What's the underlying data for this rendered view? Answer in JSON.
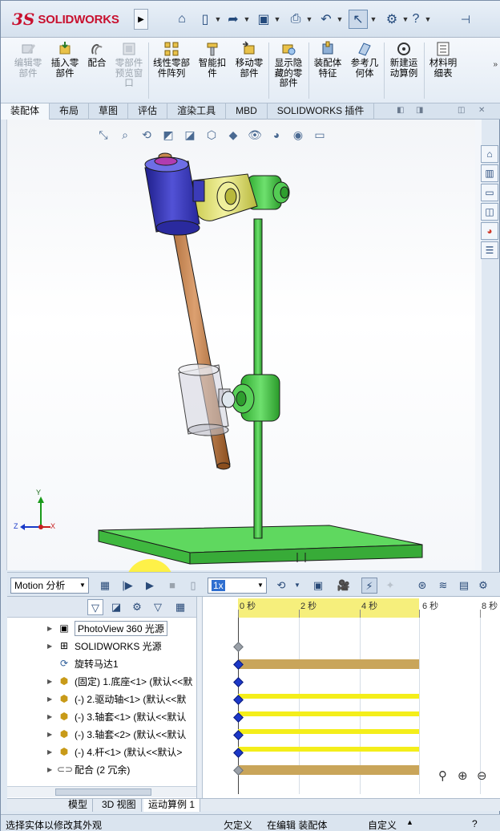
{
  "app": {
    "brand": "SOLIDWORKS",
    "brand_prefix": "3S"
  },
  "quick_access": [
    "home-icon",
    "new-file-icon",
    "open-icon",
    "save-icon",
    "print-icon",
    "undo-icon",
    "select-icon",
    "help-icon"
  ],
  "command_manager": {
    "buttons": [
      {
        "label": "编辑零\n部件",
        "disabled": true,
        "icon": "edit-component-icon"
      },
      {
        "label": "插入零\n部件",
        "disabled": false,
        "icon": "insert-component-icon"
      },
      {
        "label": "配合",
        "disabled": false,
        "icon": "mate-icon"
      },
      {
        "label": "零部件\n预览窗\n口",
        "disabled": true,
        "icon": "component-preview-icon"
      },
      {
        "label": "线性零部\n件阵列",
        "disabled": false,
        "icon": "linear-pattern-icon"
      },
      {
        "label": "智能扣\n件",
        "disabled": false,
        "icon": "smart-fastener-icon"
      },
      {
        "label": "移动零\n部件",
        "disabled": false,
        "icon": "move-component-icon"
      },
      {
        "label": "显示隐\n藏的零\n部件",
        "disabled": false,
        "icon": "show-hidden-icon"
      },
      {
        "label": "装配体\n特征",
        "disabled": false,
        "icon": "assembly-feature-icon"
      },
      {
        "label": "参考几\n何体",
        "disabled": false,
        "icon": "reference-geometry-icon"
      },
      {
        "label": "新建运\n动算例",
        "disabled": false,
        "icon": "new-motion-study-icon"
      },
      {
        "label": "材料明\n细表",
        "disabled": false,
        "icon": "bom-icon"
      }
    ]
  },
  "tabs": [
    "装配体",
    "布局",
    "草图",
    "评估",
    "渲染工具",
    "MBD",
    "SOLIDWORKS 插件"
  ],
  "active_tab": 0,
  "triad": {
    "x": "X",
    "y": "Y",
    "z": "Z"
  },
  "motion_toolbar": {
    "study_type": "Motion 分析",
    "speed": "1x"
  },
  "timeline": {
    "labels": [
      "0 秒",
      "2 秒",
      "4 秒",
      "6 秒",
      "8 秒"
    ]
  },
  "tree": [
    {
      "label": "PhotoView 360 光源",
      "icon": "photoview-icon",
      "expandable": true,
      "boxed": true
    },
    {
      "label": "SOLIDWORKS 光源",
      "icon": "lights-icon",
      "expandable": true,
      "boxed": false
    },
    {
      "label": "旋转马达1",
      "icon": "rotary-motor-icon",
      "expandable": false,
      "boxed": false
    },
    {
      "label": "(固定) 1.底座<1> (默认<<默",
      "icon": "part-icon",
      "expandable": true,
      "boxed": false
    },
    {
      "label": "(-) 2.驱动轴<1> (默认<<默",
      "icon": "part-icon",
      "expandable": true,
      "boxed": false
    },
    {
      "label": "(-) 3.轴套<1> (默认<<默认",
      "icon": "part-icon",
      "expandable": true,
      "boxed": false
    },
    {
      "label": "(-) 3.轴套<2> (默认<<默认",
      "icon": "part-icon",
      "expandable": true,
      "boxed": false
    },
    {
      "label": "(-) 4.杆<1> (默认<<默认>",
      "icon": "part-icon",
      "expandable": true,
      "boxed": false
    },
    {
      "label": "配合 (2 冗余)",
      "icon": "mates-icon",
      "expandable": true,
      "boxed": false
    }
  ],
  "bottom_tabs": [
    "模型",
    "3D 视图",
    "运动算例 1"
  ],
  "active_bottom_tab": 2,
  "status": {
    "left": "选择实体以修改其外观",
    "under_defined": "欠定义",
    "editing": "在编辑 装配体",
    "custom": "自定义"
  },
  "colors": {
    "base_green": "#4fd04f",
    "drive_shaft_tan": "#c8874e",
    "sleeve_blue": "#3838c0",
    "arm_yellow": "#e6e680",
    "timeline_yellow": "#f4ee1a",
    "key_blue": "#1c38c8"
  }
}
